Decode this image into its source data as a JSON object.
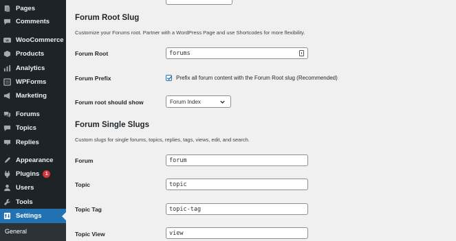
{
  "sidebar": {
    "items": [
      {
        "label": "Pages",
        "icon": "pages-icon"
      },
      {
        "label": "Comments",
        "icon": "comments-icon"
      },
      {
        "label": "WooCommerce",
        "icon": "woocommerce-icon"
      },
      {
        "label": "Products",
        "icon": "products-icon"
      },
      {
        "label": "Analytics",
        "icon": "analytics-icon"
      },
      {
        "label": "WPForms",
        "icon": "wpforms-icon"
      },
      {
        "label": "Marketing",
        "icon": "marketing-icon"
      },
      {
        "label": "Forums",
        "icon": "forums-icon"
      },
      {
        "label": "Topics",
        "icon": "topics-icon"
      },
      {
        "label": "Replies",
        "icon": "replies-icon"
      },
      {
        "label": "Appearance",
        "icon": "appearance-icon"
      },
      {
        "label": "Plugins",
        "icon": "plugins-icon",
        "badge": "1"
      },
      {
        "label": "Users",
        "icon": "users-icon"
      },
      {
        "label": "Tools",
        "icon": "tools-icon"
      },
      {
        "label": "Settings",
        "icon": "settings-icon",
        "active": true
      }
    ],
    "submenu_item": "General"
  },
  "root_section": {
    "title": "Forum Root Slug",
    "description": "Customize your Forums root. Partner with a WordPress Page and use Shortcodes for more flexibility.",
    "forum_root": {
      "label": "Forum Root",
      "value": "forums"
    },
    "forum_prefix": {
      "label": "Forum Prefix",
      "checked": true,
      "checkbox_label": "Prefix all forum content with the Forum Root slug (Recommended)"
    },
    "root_show": {
      "label": "Forum root should show",
      "selected": "Forum Index"
    }
  },
  "single_section": {
    "title": "Forum Single Slugs",
    "description": "Custom slugs for single forums, topics, replies, tags, views, edit, and search.",
    "fields": [
      {
        "label": "Forum",
        "value": "forum"
      },
      {
        "label": "Topic",
        "value": "topic"
      },
      {
        "label": "Topic Tag",
        "value": "topic-tag"
      },
      {
        "label": "Topic View",
        "value": "view"
      }
    ]
  },
  "colors": {
    "sidebar_bg": "#1d2327",
    "active_bg": "#2271b1",
    "badge": "#d63638",
    "content_bg": "#f0f0f1"
  }
}
